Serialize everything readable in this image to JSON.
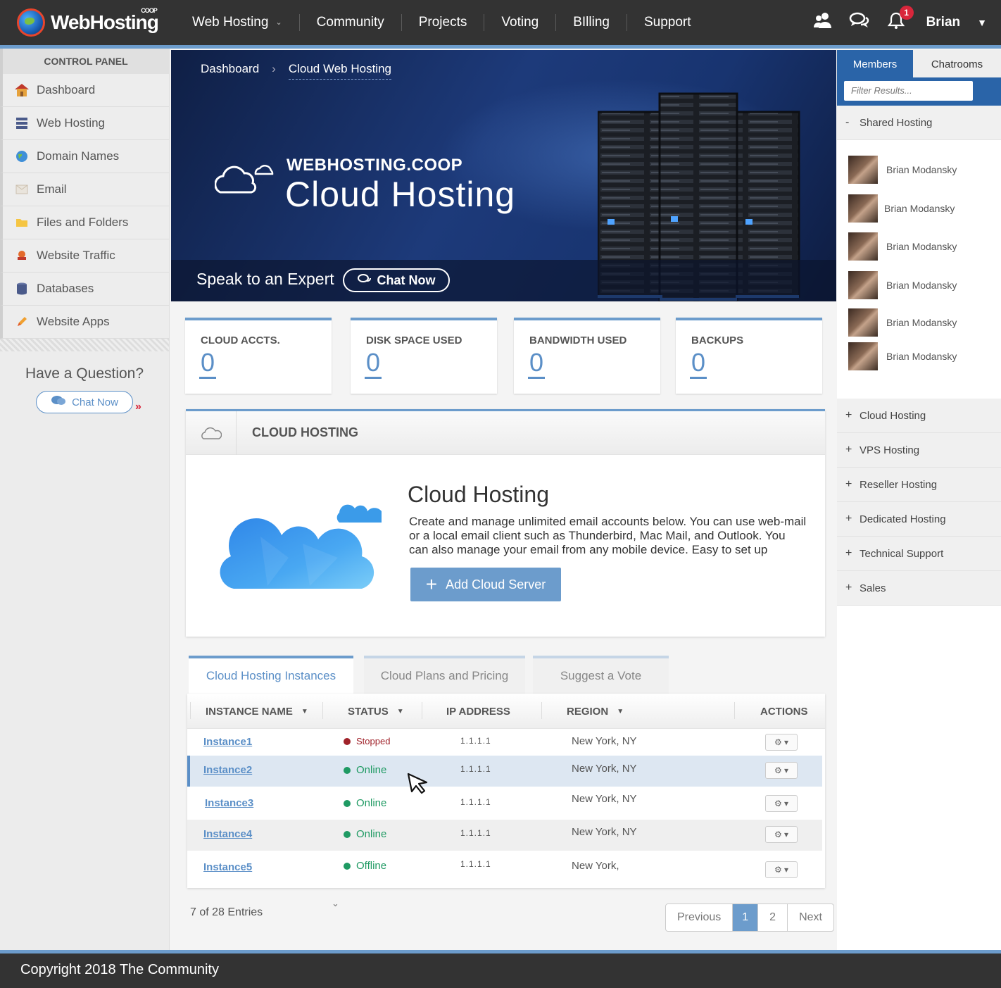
{
  "header": {
    "logo_text": "WebHosting",
    "logo_sup": "COOP",
    "nav": [
      {
        "label": "Web Hosting",
        "has_dropdown": true
      },
      {
        "label": "Community"
      },
      {
        "label": "Projects"
      },
      {
        "label": "Voting"
      },
      {
        "label": "BIlling"
      },
      {
        "label": "Support"
      }
    ],
    "notification_count": "1",
    "user_name": "Brian",
    "icons": [
      "users-icon",
      "chat-bubbles-icon",
      "bell-icon",
      "caret-down-icon"
    ]
  },
  "sidebar": {
    "title": "CONTROL PANEL",
    "items": [
      {
        "label": "Dashboard",
        "icon": "house-icon"
      },
      {
        "label": "Web Hosting",
        "icon": "server-stack-icon"
      },
      {
        "label": "Domain Names",
        "icon": "globe-icon"
      },
      {
        "label": "Email",
        "icon": "envelope-icon"
      },
      {
        "label": "Files and Folders",
        "icon": "folder-icon"
      },
      {
        "label": "Website Traffic",
        "icon": "traffic-icon"
      },
      {
        "label": "Databases",
        "icon": "database-icon"
      },
      {
        "label": "Website Apps",
        "icon": "pencil-icon"
      }
    ],
    "question": "Have a Question?",
    "chat_label": "Chat Now",
    "more_glyph": "»"
  },
  "banner": {
    "breadcrumb": [
      "Dashboard",
      "Cloud Web Hosting"
    ],
    "breadcrumb_sep": "›",
    "kicker": "WEBHOSTING.COOP",
    "title": "Cloud Hosting",
    "expert_text": "Speak to an Expert",
    "chat_label": "Chat Now"
  },
  "stats": [
    {
      "label": "CLOUD ACCTS.",
      "value": "0"
    },
    {
      "label": "DISK SPACE USED",
      "value": "0"
    },
    {
      "label": "BANDWIDTH USED",
      "value": "0"
    },
    {
      "label": "BACKUPS",
      "value": "0"
    }
  ],
  "panel": {
    "header": "CLOUD HOSTING",
    "title": "Cloud Hosting",
    "description": "Create and manage unlimited email accounts below. You can use web-mail or a local email client such as Thunderbird, Mac Mail, and Outlook. You can also manage your email from any mobile device. Easy to set up",
    "add_button": "Add Cloud Server",
    "add_glyph": "+"
  },
  "tabs": [
    {
      "label": "Cloud Hosting Instances",
      "active": true
    },
    {
      "label": "Cloud Plans and Pricing",
      "active": false
    },
    {
      "label": "Suggest a Vote",
      "active": false
    }
  ],
  "table": {
    "columns": [
      "INSTANCE NAME",
      "STATUS",
      "IP ADDRESS",
      "REGION",
      "ACTIONS"
    ],
    "rows": [
      {
        "name": "Instance1",
        "status": "Stopped",
        "status_color": "#a0222a",
        "ip": "1.1.1.1",
        "region": "New York, NY"
      },
      {
        "name": "Instance2",
        "status": "Online",
        "status_color": "#1f9a63",
        "ip": "1.1.1.1",
        "region": "New York, NY"
      },
      {
        "name": "Instance3",
        "status": "Online",
        "status_color": "#1f9a63",
        "ip": "1.1.1.1",
        "region": "New York, NY"
      },
      {
        "name": "Instance4",
        "status": "Online",
        "status_color": "#1f9a63",
        "ip": "1.1.1.1",
        "region": "New York, NY"
      },
      {
        "name": "Instance5",
        "status": "Offline",
        "status_color": "#1f9a63",
        "ip": "1.1.1.1",
        "region": "New York,"
      }
    ],
    "action_glyph": "⚙ ▾"
  },
  "entries": "7 of 28 Entries",
  "pagination": {
    "prev": "Previous",
    "pages": [
      "1",
      "2"
    ],
    "current": "1",
    "next": "Next"
  },
  "right_sidebar": {
    "tabs": [
      "Members",
      "Chatrooms"
    ],
    "filter_placeholder": "Filter Results...",
    "open_group": {
      "sign": "-",
      "label": "Shared Hosting"
    },
    "members": [
      "Brian Modansky",
      "Brian Modansky",
      "Brian Modansky",
      "Brian Modansky",
      "Brian Modansky",
      "Brian Modansky"
    ],
    "groups": [
      {
        "sign": "+",
        "label": "Cloud Hosting"
      },
      {
        "sign": "+",
        "label": "VPS Hosting"
      },
      {
        "sign": "+",
        "label": "Reseller Hosting"
      },
      {
        "sign": "+",
        "label": "Dedicated Hosting"
      },
      {
        "sign": "+",
        "label": "Technical Support"
      },
      {
        "sign": "+",
        "label": "Sales"
      }
    ]
  },
  "footer": "Copyright 2018 The Community",
  "colors": {
    "accent": "#6c9ccc",
    "topbar": "#333333",
    "link": "#5b8fc7",
    "online": "#1f9a63",
    "stopped": "#a0222a"
  }
}
